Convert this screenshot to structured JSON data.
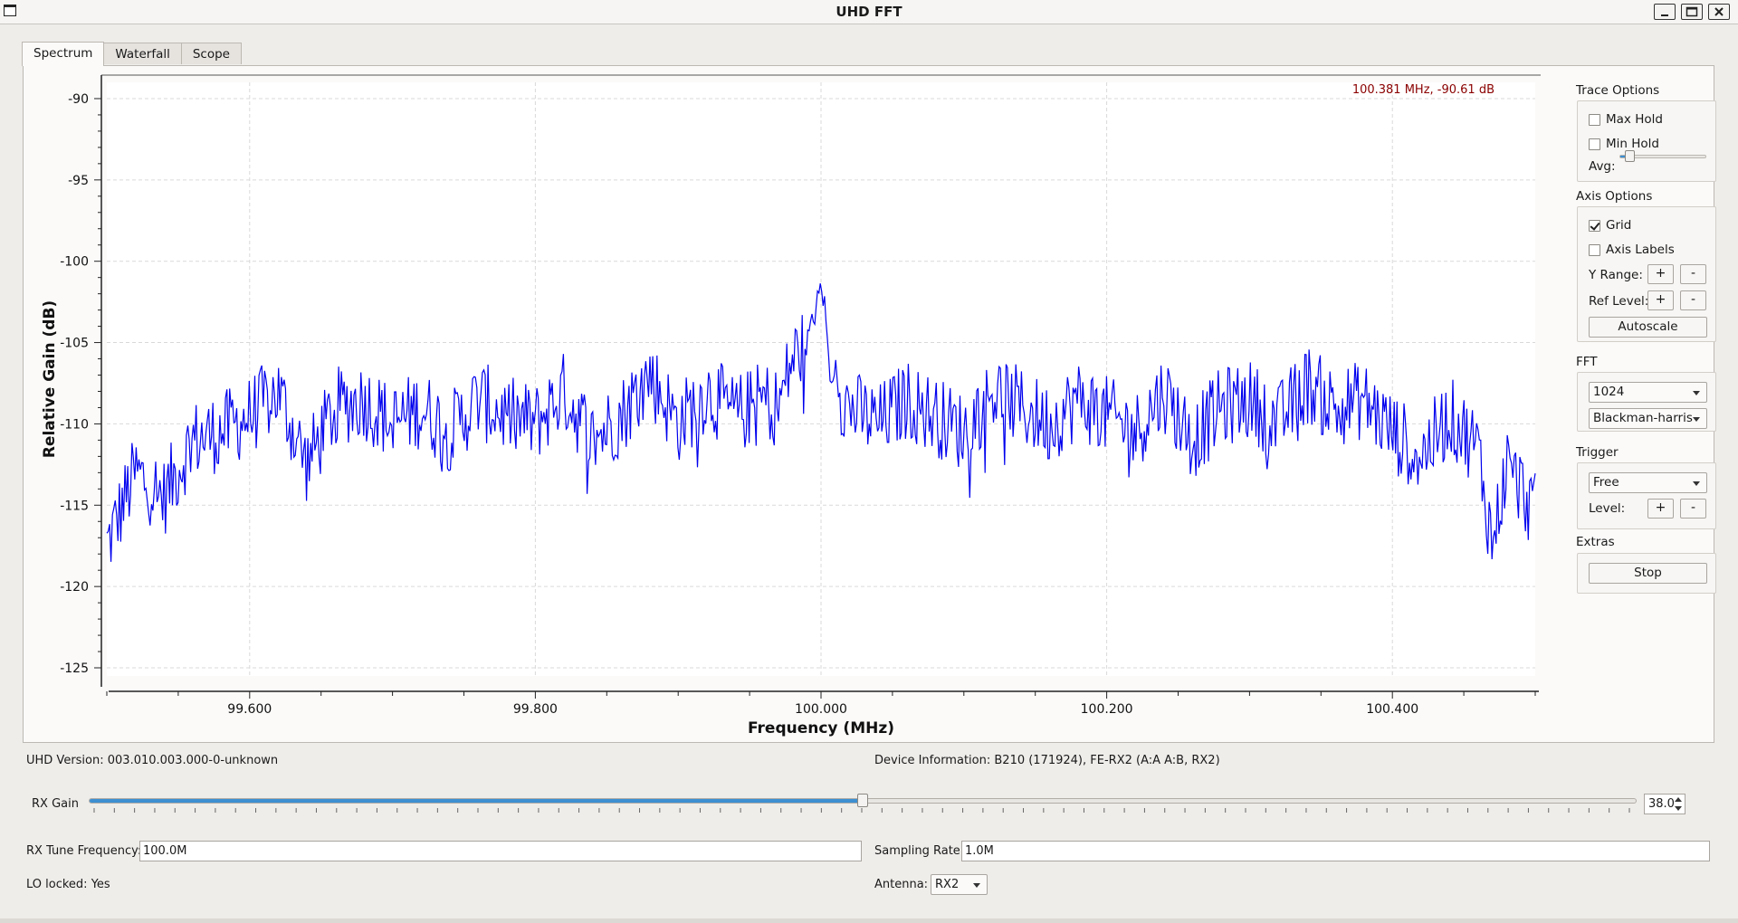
{
  "window": {
    "title": "UHD FFT",
    "minimize_icon": "minimize-icon",
    "maximize_icon": "maximize-icon",
    "close_icon": "close-icon"
  },
  "tabs": [
    {
      "label": "Spectrum",
      "active": true
    },
    {
      "label": "Waterfall",
      "active": false
    },
    {
      "label": "Scope",
      "active": false
    }
  ],
  "spectrum": {
    "marker_text": "100.381 MHz, -90.61 dB",
    "trace_color": "#0000ee",
    "marker_color": "#8b0000"
  },
  "chart_data": {
    "type": "line",
    "xlabel": "Frequency (MHz)",
    "ylabel": "Relative Gain (dB)",
    "xlim": [
      99.5,
      100.5
    ],
    "ylim": [
      -125.5,
      -89
    ],
    "x_ticks": [
      99.6,
      99.8,
      100.0,
      100.2,
      100.4
    ],
    "x_tick_labels": [
      "99.600",
      "99.800",
      "100.000",
      "100.200",
      "100.400"
    ],
    "y_ticks": [
      -90,
      -95,
      -100,
      -105,
      -110,
      -115,
      -120,
      -125
    ],
    "y_tick_labels": [
      "-90",
      "-95",
      "-100",
      "-105",
      "-110",
      "-115",
      "-120",
      "-125"
    ],
    "grid": true,
    "series": [
      {
        "x": [
          99.5,
          99.52,
          99.54,
          99.56,
          99.58,
          99.6,
          99.62,
          99.64,
          99.66,
          99.68,
          99.7,
          99.72,
          99.74,
          99.76,
          99.78,
          99.8,
          99.82,
          99.84,
          99.86,
          99.88,
          99.9,
          99.92,
          99.94,
          99.96,
          99.97,
          99.98,
          99.99,
          99.995,
          100.0,
          100.003,
          100.006,
          100.01,
          100.015,
          100.02,
          100.04,
          100.06,
          100.08,
          100.1,
          100.12,
          100.14,
          100.16,
          100.18,
          100.2,
          100.22,
          100.24,
          100.26,
          100.28,
          100.3,
          100.32,
          100.34,
          100.36,
          100.38,
          100.4,
          100.42,
          100.44,
          100.46,
          100.47,
          100.48,
          100.49,
          100.5
        ],
        "y": [
          -117.5,
          -113.0,
          -114.5,
          -111.0,
          -110.5,
          -109.5,
          -108.0,
          -112.5,
          -109.0,
          -108.5,
          -110.0,
          -109.0,
          -110.5,
          -108.5,
          -109.5,
          -110.0,
          -108.0,
          -111.0,
          -109.5,
          -107.0,
          -110.0,
          -108.0,
          -109.5,
          -108.5,
          -109.0,
          -106.0,
          -105.0,
          -103.5,
          -101.5,
          -103.0,
          -107.0,
          -106.5,
          -108.5,
          -109.0,
          -110.0,
          -108.5,
          -109.5,
          -110.5,
          -108.0,
          -109.0,
          -110.0,
          -108.5,
          -109.5,
          -110.5,
          -108.0,
          -111.0,
          -109.0,
          -108.5,
          -110.0,
          -107.5,
          -109.0,
          -108.5,
          -110.5,
          -112.0,
          -109.5,
          -111.5,
          -117.5,
          -112.5,
          -114.0,
          -115.5
        ]
      }
    ]
  },
  "trace_options": {
    "title": "Trace Options",
    "max_hold": {
      "label": "Max Hold",
      "checked": false
    },
    "min_hold": {
      "label": "Min Hold",
      "checked": false
    },
    "avg_label": "Avg:",
    "avg_level": 0.08
  },
  "axis_options": {
    "title": "Axis Options",
    "grid": {
      "label": "Grid",
      "checked": true
    },
    "axis_labels": {
      "label": "Axis Labels",
      "checked": false
    },
    "y_range_label": "Y Range:",
    "ref_level_label": "Ref Level:",
    "plus": "+",
    "minus": "-",
    "autoscale_label": "Autoscale"
  },
  "fft": {
    "title": "FFT",
    "size": "1024",
    "window": "Blackman-harris"
  },
  "trigger": {
    "title": "Trigger",
    "mode": "Free",
    "level_label": "Level:"
  },
  "extras": {
    "title": "Extras",
    "stop_label": "Stop"
  },
  "info": {
    "uhd_version_label": "UHD Version:",
    "uhd_version": "003.010.003.000-0-unknown",
    "device_info_label": "Device Information:",
    "device_info": "B210 (171924), FE-RX2 (A:A A:B, RX2)"
  },
  "rx_gain": {
    "label": "RX Gain",
    "value": "38.0",
    "fraction": 0.5
  },
  "tuning": {
    "rx_tune_label": "RX Tune Frequency:",
    "rx_tune_value": "100.0M",
    "sampling_rate_label": "Sampling Rate:",
    "sampling_rate_value": "1.0M",
    "lo_locked_label": "LO locked:",
    "lo_locked_value": "Yes",
    "antenna_label": "Antenna:",
    "antenna_value": "RX2"
  }
}
